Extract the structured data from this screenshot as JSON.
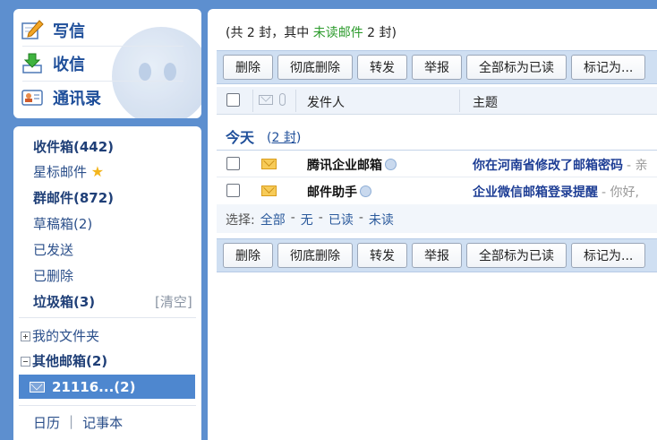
{
  "sidebar": {
    "actions": [
      {
        "label": "写信",
        "icon": "compose-icon"
      },
      {
        "label": "收信",
        "icon": "receive-icon"
      },
      {
        "label": "通讯录",
        "icon": "contacts-icon"
      }
    ],
    "folders": {
      "inbox": "收件箱(442)",
      "starred": "星标邮件",
      "group": "群邮件(872)",
      "drafts": "草稿箱(2)",
      "sent": "已发送",
      "deleted": "已删除",
      "spam": "垃圾箱(3)",
      "clear": "[清空]",
      "my_folders": "我的文件夹",
      "other_mailboxes": "其他邮箱(2)",
      "account": "21116...(2)"
    },
    "links": {
      "calendar": "日历",
      "separator": "|",
      "notes": "记事本"
    }
  },
  "main": {
    "summary_prefix": "(共 2 封，其中 ",
    "summary_unread": "未读邮件",
    "summary_suffix": " 2 封)",
    "toolbar": {
      "delete": "删除",
      "delete_permanently": "彻底删除",
      "forward": "转发",
      "report": "举报",
      "mark_all_read": "全部标为已读",
      "mark_as": "标记为..."
    },
    "columns": {
      "sender": "发件人",
      "subject": "主题"
    },
    "group": {
      "label": "今天",
      "open": "(",
      "count": "2 封",
      "close": ")"
    },
    "mails": [
      {
        "sender": "腾讯企业邮箱",
        "subject": "你在河南省修改了邮箱密码",
        "preview": "- 亲"
      },
      {
        "sender": "邮件助手",
        "subject": "企业微信邮箱登录提醒",
        "preview": "- 你好,"
      }
    ],
    "select": {
      "label": "选择:",
      "all": "全部",
      "none": "无",
      "read": "已读",
      "unread": "未读",
      "dash": "-"
    }
  },
  "colors": {
    "background": "#5d8fcf",
    "accent": "#1f4f9a",
    "unread_green": "#2c9b2c",
    "selected": "#4e87cf"
  }
}
